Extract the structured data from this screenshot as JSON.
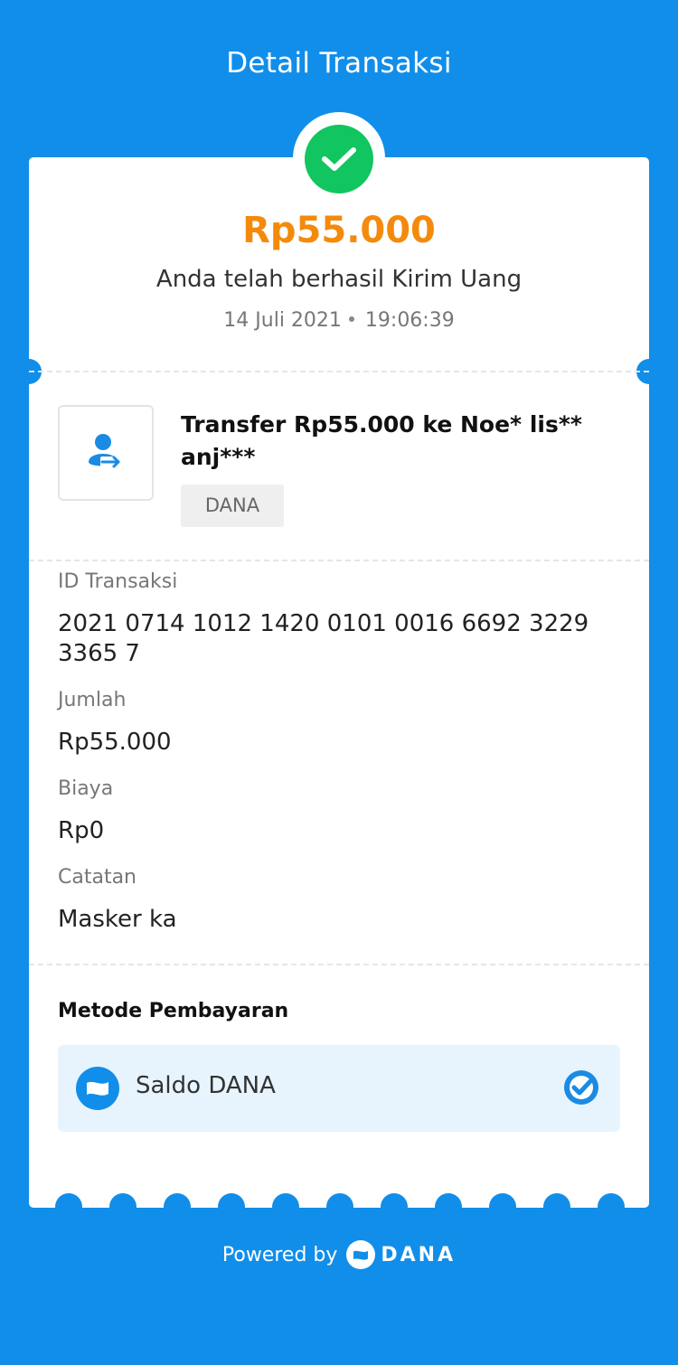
{
  "header": {
    "title": "Detail Transaksi"
  },
  "summary": {
    "status_icon": "check-circle-icon",
    "amount": "Rp55.000",
    "message": "Anda telah berhasil Kirim Uang",
    "date": "14 Juli 2021",
    "time": "19:06:39"
  },
  "transaction": {
    "icon": "user-transfer-icon",
    "title": "Transfer Rp55.000 ke Noe* lis** anj***",
    "tag": "DANA"
  },
  "details": [
    {
      "label": "ID Transaksi",
      "value": "2021 0714 1012 1420 0101 0016 6692 3229 3365 7"
    },
    {
      "label": "Jumlah",
      "value": "Rp55.000"
    },
    {
      "label": "Biaya",
      "value": "Rp0"
    },
    {
      "label": "Catatan",
      "value": "Masker ka"
    }
  ],
  "payment": {
    "section_title": "Metode Pembayaran",
    "method_label": "Saldo DANA",
    "method_icon": "dana-wallet-icon",
    "selected_icon": "check-badge-icon"
  },
  "footer": {
    "powered_by": "Powered by",
    "brand": "DANA"
  },
  "colors": {
    "background": "#118ee9",
    "accent_amount": "#f48a0c",
    "success": "#11c560",
    "method_bg": "#e7f4fd"
  }
}
